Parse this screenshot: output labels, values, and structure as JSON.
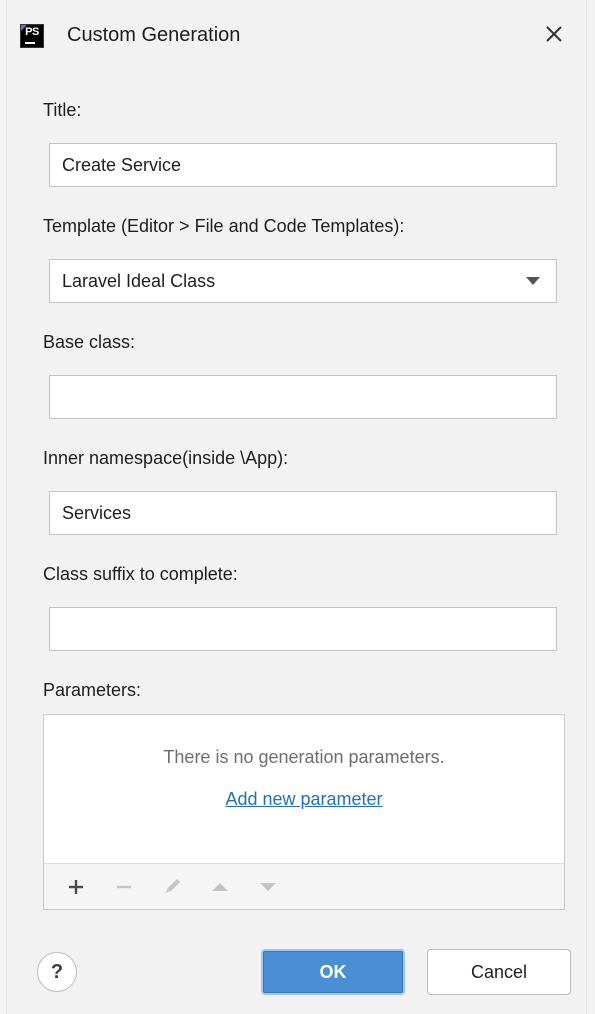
{
  "window": {
    "app_icon_text": "PS",
    "title": "Custom Generation"
  },
  "form": {
    "title_label": "Title:",
    "title_value": "Create Service",
    "template_label": "Template (Editor > File and Code Templates):",
    "template_value": "Laravel Ideal Class",
    "base_class_label": "Base class:",
    "base_class_value": "",
    "namespace_label": "Inner namespace(inside \\App):",
    "namespace_value": "Services",
    "suffix_label": "Class suffix to complete:",
    "suffix_value": ""
  },
  "parameters": {
    "label": "Parameters:",
    "empty_text": "There is no generation parameters.",
    "add_link": "Add new parameter",
    "toolbar_icons": [
      "plus-icon",
      "minus-icon",
      "pencil-icon",
      "arrow-up-icon",
      "arrow-down-icon"
    ]
  },
  "footer": {
    "help_label": "?",
    "ok_label": "OK",
    "cancel_label": "Cancel"
  },
  "colors": {
    "background": "#f2f2f2",
    "primary_button": "#4a8fd4",
    "link": "#2470b3"
  }
}
